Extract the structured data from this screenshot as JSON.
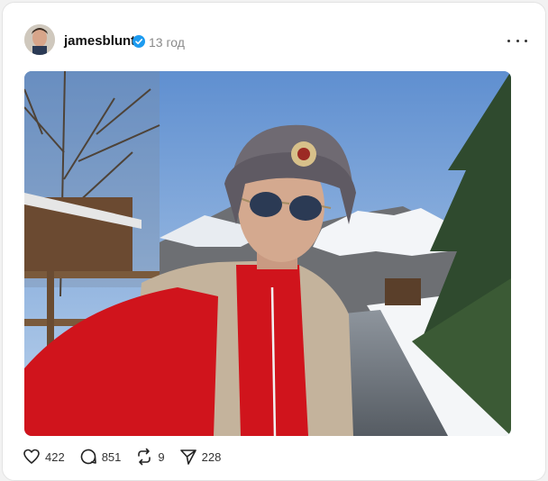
{
  "post": {
    "username": "jamesblunt",
    "verified": true,
    "timestamp": "13 год",
    "menu_icon": "more-horizontal-icon",
    "image_subject": "selfie of man in fur ushanka hat and sunglasses, red top and sheepskin vest, snowy mountain path"
  },
  "actions": {
    "likes": "422",
    "comments": "851",
    "reposts": "9",
    "shares": "228"
  },
  "colors": {
    "verified_badge": "#1d9bf0",
    "text_primary": "#111111",
    "text_secondary": "#8a8a8a"
  }
}
